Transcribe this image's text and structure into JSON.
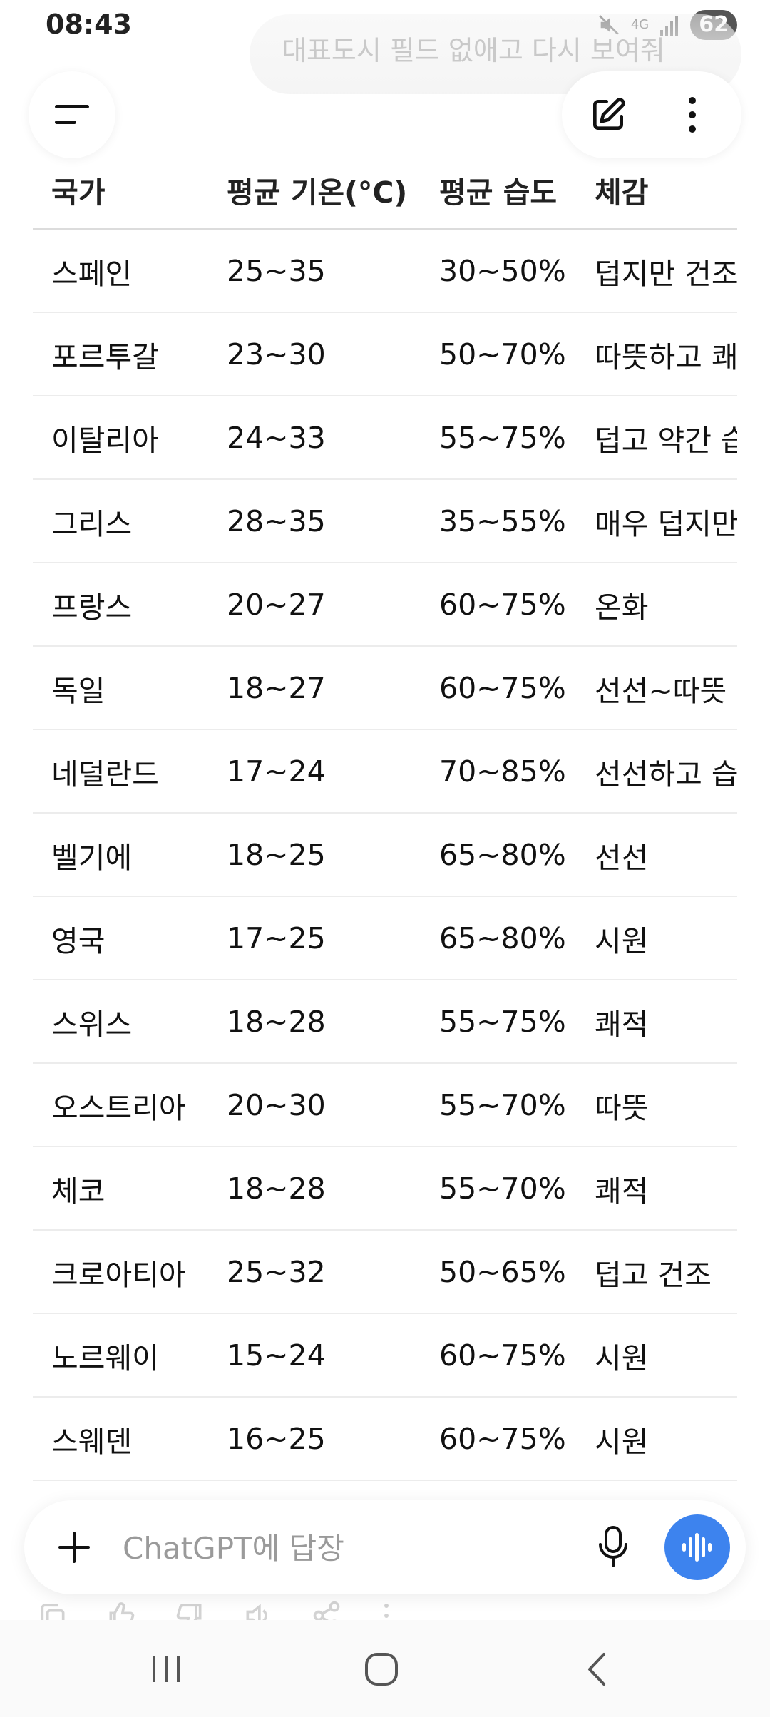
{
  "status_bar": {
    "time": "08:43",
    "network": "4G",
    "battery": "62"
  },
  "previous_message": {
    "text": "대표도시 필드 없애고 다시 보여줘"
  },
  "header": {
    "menu_icon": "menu-icon",
    "compose_icon": "edit-icon",
    "more_icon": "more-vertical-icon"
  },
  "table": {
    "columns": [
      "국가",
      "평균 기온(°C)",
      "평균 습도",
      "체감"
    ],
    "rows": [
      {
        "country": "스페인",
        "temp": "25~35",
        "humidity": "30~50%",
        "feel": "덥지만 건조"
      },
      {
        "country": "포르투갈",
        "temp": "23~30",
        "humidity": "50~70%",
        "feel": "따뜻하고 쾌"
      },
      {
        "country": "이탈리아",
        "temp": "24~33",
        "humidity": "55~75%",
        "feel": "덥고 약간 습"
      },
      {
        "country": "그리스",
        "temp": "28~35",
        "humidity": "35~55%",
        "feel": "매우 덥지만"
      },
      {
        "country": "프랑스",
        "temp": "20~27",
        "humidity": "60~75%",
        "feel": "온화"
      },
      {
        "country": "독일",
        "temp": "18~27",
        "humidity": "60~75%",
        "feel": "선선~따뜻"
      },
      {
        "country": "네덜란드",
        "temp": "17~24",
        "humidity": "70~85%",
        "feel": "선선하고 습"
      },
      {
        "country": "벨기에",
        "temp": "18~25",
        "humidity": "65~80%",
        "feel": "선선"
      },
      {
        "country": "영국",
        "temp": "17~25",
        "humidity": "65~80%",
        "feel": "시원"
      },
      {
        "country": "스위스",
        "temp": "18~28",
        "humidity": "55~75%",
        "feel": "쾌적"
      },
      {
        "country": "오스트리아",
        "temp": "20~30",
        "humidity": "55~70%",
        "feel": "따뜻"
      },
      {
        "country": "체코",
        "temp": "18~28",
        "humidity": "55~70%",
        "feel": "쾌적"
      },
      {
        "country": "크로아티아",
        "temp": "25~32",
        "humidity": "50~65%",
        "feel": "덥고 건조"
      },
      {
        "country": "노르웨이",
        "temp": "15~24",
        "humidity": "60~75%",
        "feel": "시원"
      },
      {
        "country": "스웨덴",
        "temp": "16~25",
        "humidity": "60~75%",
        "feel": "시원"
      }
    ]
  },
  "composer": {
    "placeholder": "ChatGPT에 답장",
    "voice_color": "#3d83ee"
  },
  "message_actions": [
    "copy-icon",
    "thumbs-up-icon",
    "thumbs-down-icon",
    "speaker-icon",
    "share-icon",
    "more-icon"
  ],
  "nav": {
    "recent_icon": "recent-apps-icon",
    "home_icon": "home-icon",
    "back_icon": "back-icon"
  }
}
